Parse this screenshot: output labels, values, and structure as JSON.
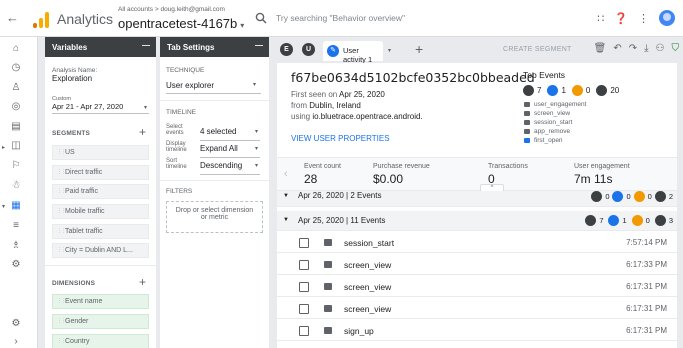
{
  "topbar": {
    "app_name": "Analytics",
    "account_line": "All accounts > doug.leith@gmail.com",
    "property": "opentracetest-4167b",
    "search_placeholder": "Try searching \"Behavior overview\""
  },
  "variables": {
    "header": "Variables",
    "analysis_name_label": "Analysis Name:",
    "analysis_name": "Exploration",
    "date_label": "Custom",
    "date_range": "Apr 21 - Apr 27, 2020",
    "segments_header": "SEGMENTS",
    "segments": [
      "US",
      "Direct traffic",
      "Paid traffic",
      "Mobile traffic",
      "Tablet traffic",
      "City = Dublin AND L..."
    ],
    "dimensions_header": "DIMENSIONS",
    "dimensions": [
      "Event name",
      "Gender",
      "Country"
    ]
  },
  "tab_settings": {
    "header": "Tab Settings",
    "technique_label": "TECHNIQUE",
    "technique": "User explorer",
    "timeline_label": "TIMELINE",
    "select_events_label": "Select events",
    "select_events": "4 selected",
    "display_timeline_label": "Display timeline",
    "display_timeline": "Expand All",
    "sort_timeline_label": "Sort timeline",
    "sort_timeline": "Descending",
    "filters_label": "FILTERS",
    "filters_drop": "Drop or select dimension or metric"
  },
  "tabs": {
    "seg_e": "E",
    "seg_u": "U",
    "active_tab": "User activity 1",
    "create_segment": "CREATE SEGMENT"
  },
  "user": {
    "id": "f67be0634d5102bcfe0352bc0bbeaded",
    "first_seen_prefix": "First seen on ",
    "first_seen_date": "Apr 25, 2020",
    "from_prefix": "from ",
    "from_city": "Dublin, Ireland",
    "using_prefix": "using ",
    "using_app": "io.bluetrace.opentrace.android.",
    "view_props": "VIEW USER PROPERTIES"
  },
  "top_events": {
    "title": "Top Events",
    "counts": [
      "7",
      "1",
      "0",
      "20"
    ],
    "list": [
      "user_engagement",
      "screen_view",
      "session_start",
      "app_remove",
      "first_open"
    ]
  },
  "metrics": [
    {
      "label": "Event count",
      "value": "28"
    },
    {
      "label": "Purchase revenue",
      "value": "$0.00"
    },
    {
      "label": "Transactions",
      "value": "0"
    },
    {
      "label": "User engagement",
      "value": "7m 11s"
    }
  ],
  "groups": [
    {
      "title": "Apr 26, 2020 | 2 Events",
      "counts": [
        "0",
        "0",
        "0",
        "2"
      ]
    },
    {
      "title": "Apr 25, 2020 | 11 Events",
      "counts": [
        "7",
        "1",
        "0",
        "3"
      ]
    }
  ],
  "events": [
    {
      "name": "session_start",
      "time": "7:57:14 PM"
    },
    {
      "name": "screen_view",
      "time": "6:17:33 PM"
    },
    {
      "name": "screen_view",
      "time": "6:17:31 PM"
    },
    {
      "name": "screen_view",
      "time": "6:17:31 PM"
    },
    {
      "name": "sign_up",
      "time": "6:17:31 PM"
    }
  ],
  "colors": {
    "accent": "#1a73e8",
    "panel_header": "#3c4043",
    "orange": "#f29900",
    "dark": "#3c4043",
    "logo_orange": "#f9ab00",
    "logo_dark_orange": "#e37400"
  }
}
